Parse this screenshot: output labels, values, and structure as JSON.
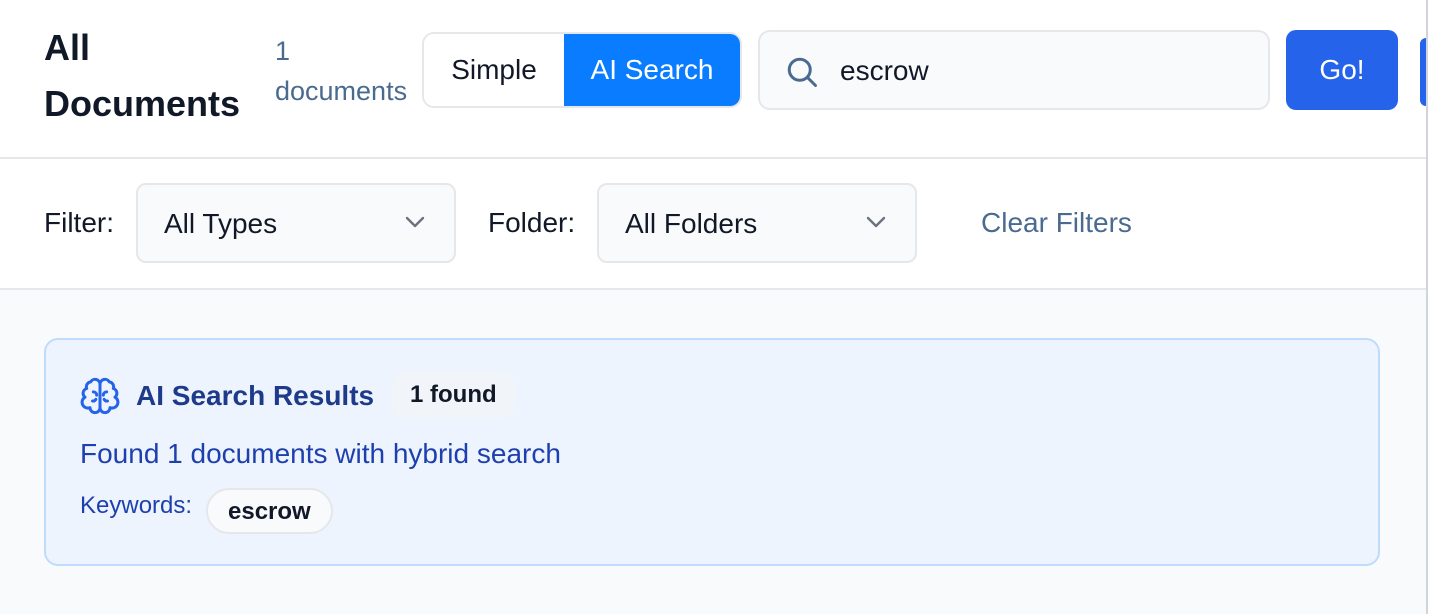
{
  "header": {
    "title": "All Documents",
    "count": "1 documents"
  },
  "search_mode": {
    "options": [
      "Simple",
      "AI Search"
    ],
    "selected": "AI Search"
  },
  "search": {
    "icon": "search-icon",
    "value": "escrow",
    "go_label": "Go!"
  },
  "filters": {
    "type_label": "Filter:",
    "type_value": "All Types",
    "folder_label": "Folder:",
    "folder_value": "All Folders",
    "clear_label": "Clear Filters"
  },
  "results": {
    "icon": "brain-icon",
    "title": "AI Search Results",
    "badge": "1 found",
    "summary": "Found 1 documents with hybrid search",
    "keywords_label": "Keywords:",
    "keywords": [
      "escrow"
    ]
  },
  "colors": {
    "accent": "#0a7cff",
    "go_button": "#2563eb",
    "results_bg": "#eef4fd",
    "results_border": "#bfdbfe",
    "results_title": "#1e3a8a",
    "muted_link": "#4a6b8f"
  }
}
